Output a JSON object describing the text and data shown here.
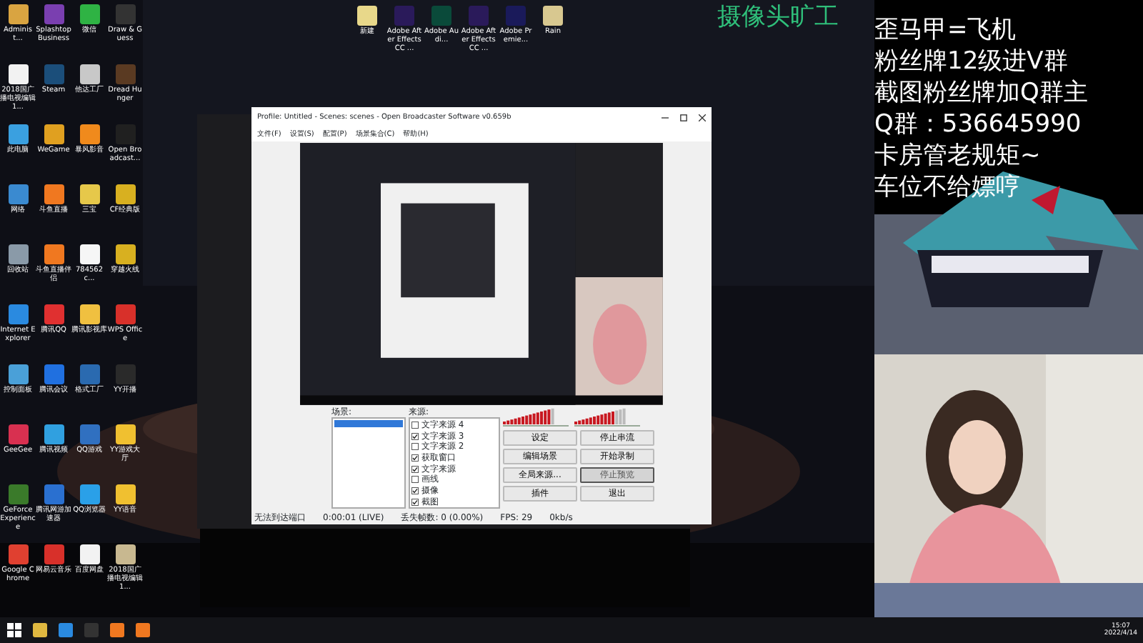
{
  "desktop_icons": [
    {
      "label": "Administ...",
      "color": "#d9a441"
    },
    {
      "label": "Splashtop Business",
      "color": "#7a3fb0"
    },
    {
      "label": "微信",
      "color": "#2fb344"
    },
    {
      "label": "Draw & Guess",
      "color": "#333333"
    },
    {
      "label": "2018国广播电视编辑1...",
      "color": "#f2f2f2"
    },
    {
      "label": "Steam",
      "color": "#1b4e7a"
    },
    {
      "label": "他达工厂",
      "color": "#c8c8c8"
    },
    {
      "label": "Dread Hunger",
      "color": "#5a3a22"
    },
    {
      "label": "此电脑",
      "color": "#3aa0e0"
    },
    {
      "label": "WeGame",
      "color": "#e0a020"
    },
    {
      "label": "暴风影音",
      "color": "#f08a1c"
    },
    {
      "label": "Open Broadcast...",
      "color": "#202020"
    },
    {
      "label": "网络",
      "color": "#3a8ad0"
    },
    {
      "label": "斗鱼直播",
      "color": "#f07820"
    },
    {
      "label": "三宝",
      "color": "#e6c84a"
    },
    {
      "label": "CF经典版",
      "color": "#d8b020"
    },
    {
      "label": "回收站",
      "color": "#8a9aa8"
    },
    {
      "label": "斗鱼直播伴侣",
      "color": "#f07820"
    },
    {
      "label": "784562c...",
      "color": "#f6f6f6"
    },
    {
      "label": "穿越火线",
      "color": "#d8b020"
    },
    {
      "label": "Internet Explorer",
      "color": "#2a8ae0"
    },
    {
      "label": "腾讯QQ",
      "color": "#e03030"
    },
    {
      "label": "腾讯影视库",
      "color": "#f0c040"
    },
    {
      "label": "WPS Office",
      "color": "#d8302a"
    },
    {
      "label": "控制面板",
      "color": "#4aa0d8"
    },
    {
      "label": "腾讯会议",
      "color": "#2070e0"
    },
    {
      "label": "格式工厂",
      "color": "#2a6ab0"
    },
    {
      "label": "YY开播",
      "color": "#2a2a2a"
    },
    {
      "label": "GeeGee",
      "color": "#d83050"
    },
    {
      "label": "腾讯视频",
      "color": "#30a0e0"
    },
    {
      "label": "QQ游戏",
      "color": "#3070c0"
    },
    {
      "label": "YY游戏大厅",
      "color": "#f0c030"
    },
    {
      "label": "GeForce Experience",
      "color": "#3a7a2a"
    },
    {
      "label": "腾讯网游加速器",
      "color": "#2a70d0"
    },
    {
      "label": "QQ浏览器",
      "color": "#2aa0e8"
    },
    {
      "label": "YY语音",
      "color": "#f0c030"
    },
    {
      "label": "Google Chrome",
      "color": "#e04030"
    },
    {
      "label": "网易云音乐",
      "color": "#d8302a"
    },
    {
      "label": "百度网盘",
      "color": "#f2f2f2"
    },
    {
      "label": "2018国广播电视编辑1...",
      "color": "#c8b890"
    }
  ],
  "top_icons": [
    {
      "label": "新建",
      "color": "#e8d88a"
    },
    {
      "label": "Adobe After Effects CC ...",
      "color": "#2a1a5a"
    },
    {
      "label": "Adobe Audi...",
      "color": "#0a4a3a"
    },
    {
      "label": "Adobe After Effects CC ...",
      "color": "#2a1a5a"
    },
    {
      "label": "Adobe Premie...",
      "color": "#1a1a5a"
    },
    {
      "label": "Rain",
      "color": "#d8c890"
    }
  ],
  "watch_text": "摄像头旷工",
  "obs": {
    "title": "Profile: Untitled - Scenes: scenes - Open Broadcaster Software v0.659b",
    "menu": [
      "文件(F)",
      "设置(S)",
      "配置(P)",
      "场景集合(C)",
      "帮助(H)"
    ],
    "scenes_label": "场景:",
    "scenes": [
      {
        "selected": true
      }
    ],
    "sources_label": "来源:",
    "sources": [
      {
        "label": "文字来源 4",
        "checked": false
      },
      {
        "label": "文字来源 3",
        "checked": true
      },
      {
        "label": "文字来源 2",
        "checked": false
      },
      {
        "label": "获取窗口",
        "checked": true
      },
      {
        "label": "文字来源",
        "checked": true
      },
      {
        "label": "画线",
        "checked": false
      },
      {
        "label": "摄像",
        "checked": true
      },
      {
        "label": "截图",
        "checked": true
      }
    ],
    "meters": [
      {
        "level": 0.9
      },
      {
        "level": 0.75
      }
    ],
    "buttons": [
      {
        "label": "设定",
        "disabled": false
      },
      {
        "label": "停止串流",
        "disabled": false
      },
      {
        "label": "编辑场景",
        "disabled": false
      },
      {
        "label": "开始录制",
        "disabled": false
      },
      {
        "label": "全局来源...",
        "disabled": false
      },
      {
        "label": "停止预览",
        "disabled": true
      },
      {
        "label": "插件",
        "disabled": false
      },
      {
        "label": "退出",
        "disabled": false
      }
    ],
    "status_left": "无法到达端口",
    "status_time": "0:00:01 (LIVE)",
    "status_dropped": "丢失帧数: 0 (0.00%)",
    "status_fps": "FPS: 29",
    "status_rate": "0kb/s"
  },
  "overlay_lines": [
    "歪马甲=飞机",
    "粉丝牌12级进V群",
    "截图粉丝牌加Q群主",
    "Q群：536645990",
    "卡房管老规矩~",
    "车位不给嫖哼"
  ],
  "taskbar": {
    "time": "15:07",
    "date": "2022/4/14"
  }
}
